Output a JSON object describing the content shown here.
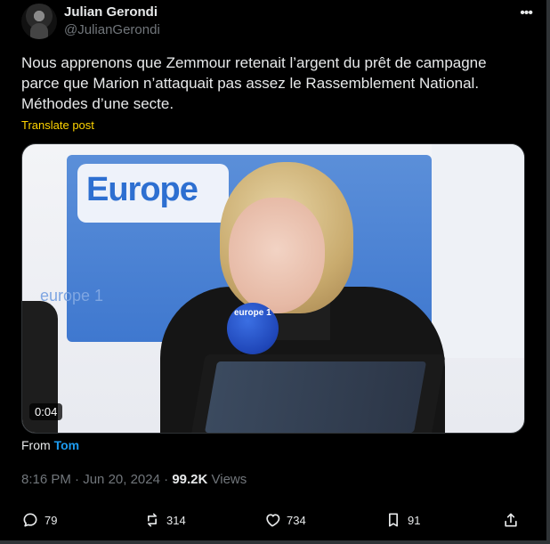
{
  "author": {
    "name": "Julian Gerondi",
    "handle": "@JulianGerondi"
  },
  "post": {
    "text": "Nous apprenons que Zemmour retenait l’argent du prêt de campagne parce que Marion n’attaquait pas assez le Rassemblement National. Méthodes d’une secte.",
    "translate_label": "Translate post"
  },
  "media": {
    "logo_text": "Europe",
    "ghost_text": "europe 1",
    "mic_label": "europe 1",
    "duration": "0:04"
  },
  "attribution": {
    "prefix": "From",
    "source": "Tom"
  },
  "meta": {
    "time": "8:16 PM",
    "separator": "·",
    "date": "Jun 20, 2024",
    "views_count": "99.2K",
    "views_label": "Views"
  },
  "actions": {
    "replies": "79",
    "reposts": "314",
    "likes": "734",
    "bookmarks": "91"
  },
  "icons": {
    "more": "more-icon",
    "reply": "reply-icon",
    "repost": "repost-icon",
    "like": "like-icon",
    "bookmark": "bookmark-icon",
    "share": "share-icon"
  },
  "colors": {
    "background": "#000000",
    "text": "#e7e9ea",
    "muted": "#71767b",
    "accent": "#1d9bf0",
    "translate": "#ffd400"
  }
}
